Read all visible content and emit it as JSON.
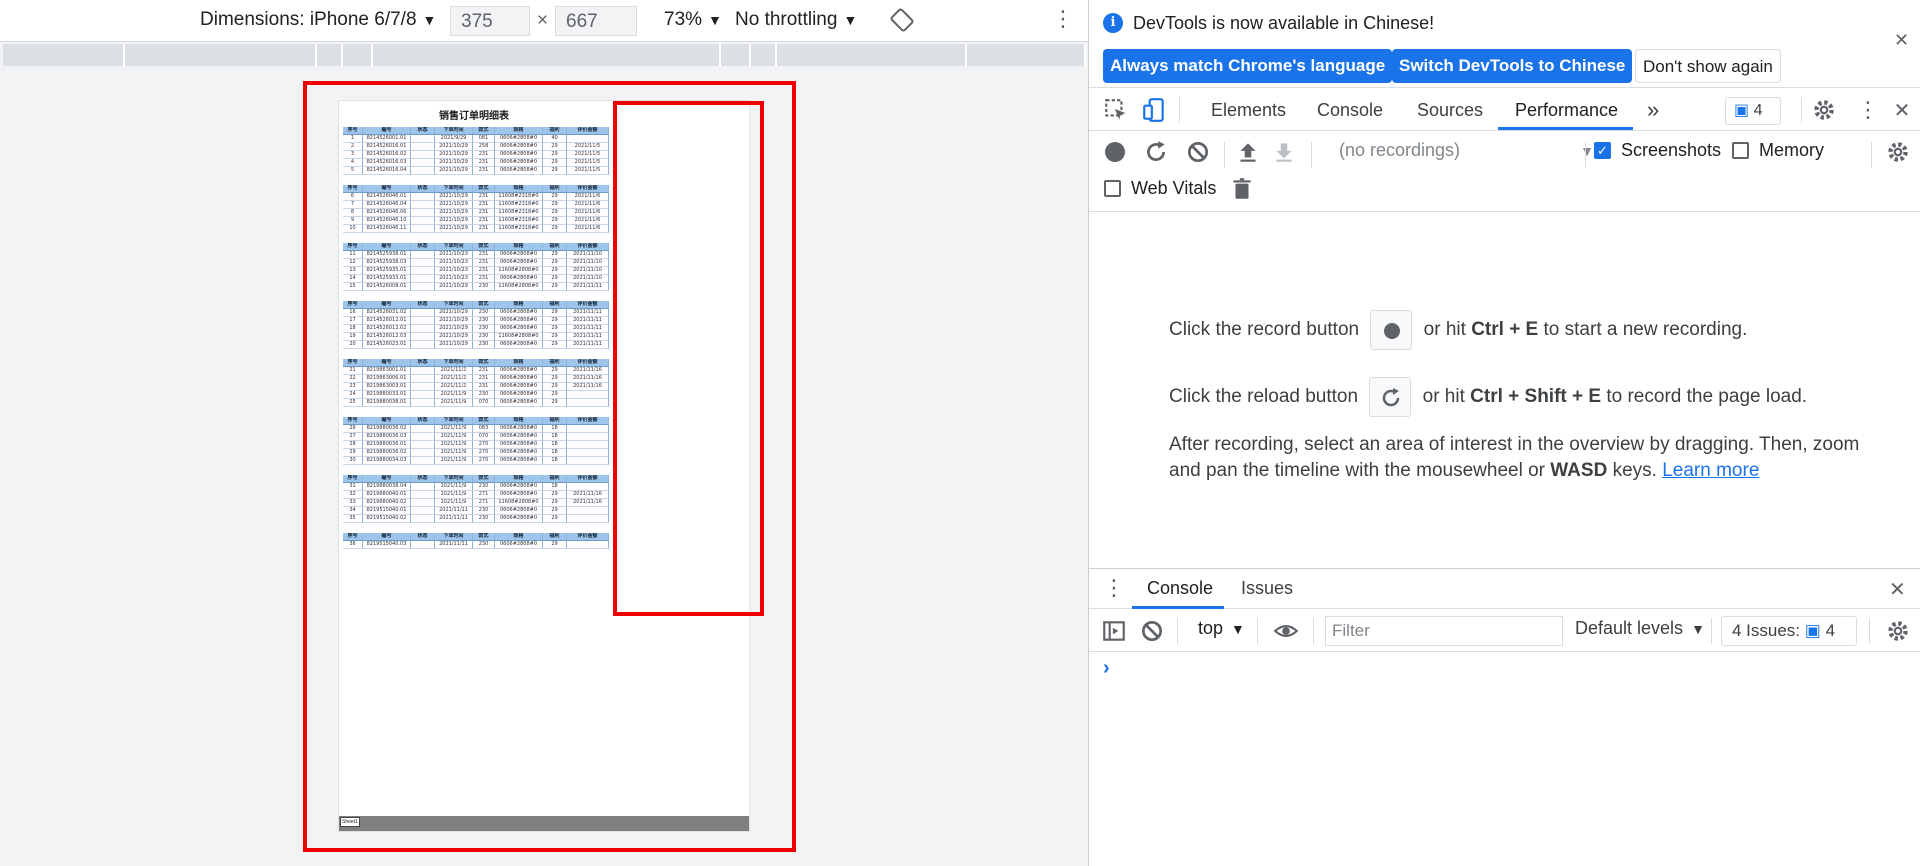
{
  "device_toolbar": {
    "dimensions_label": "Dimensions: iPhone 6/7/8",
    "width_value": "375",
    "height_value": "667",
    "times": "×",
    "zoom": "73%",
    "throttling": "No throttling"
  },
  "sheet": {
    "title": "销售订单明细表",
    "tab_name": "Sheet1",
    "headers": [
      "序号",
      "编号",
      "状态",
      "下单时间",
      "款式",
      "规格",
      "福利",
      "评价金额"
    ],
    "blocks": [
      [
        [
          "1",
          "8214526001.01",
          "",
          "2021/9/29",
          "081",
          "0606#2808#0",
          "40",
          ""
        ],
        [
          "2",
          "8214526016.01",
          "",
          "2021/10/29",
          "258",
          "0606#2808#0",
          "29",
          "2021/11/5"
        ],
        [
          "3",
          "8214526016.02",
          "",
          "2021/10/29",
          "231",
          "0606#2808#0",
          "29",
          "2021/11/5"
        ],
        [
          "4",
          "8214526016.03",
          "",
          "2021/10/29",
          "231",
          "0606#2808#0",
          "29",
          "2021/11/5"
        ],
        [
          "5",
          "8214526016.04",
          "",
          "2021/10/29",
          "231",
          "0606#2808#0",
          "29",
          "2021/11/5"
        ]
      ],
      [
        [
          "6",
          "8214526046.01",
          "",
          "2021/10/29",
          "231",
          "11608#2318#0",
          "29",
          "2021/11/6"
        ],
        [
          "7",
          "8214526046.04",
          "",
          "2021/10/29",
          "231",
          "11608#2318#0",
          "29",
          "2021/11/6"
        ],
        [
          "8",
          "8214526046.06",
          "",
          "2021/10/29",
          "231",
          "11608#2318#0",
          "29",
          "2021/11/6"
        ],
        [
          "9",
          "8214526046.10",
          "",
          "2021/10/29",
          "231",
          "11608#2318#0",
          "29",
          "2021/11/6"
        ],
        [
          "10",
          "8214526046.11",
          "",
          "2021/10/29",
          "231",
          "11608#2318#0",
          "29",
          "2021/11/6"
        ]
      ],
      [
        [
          "11",
          "8214525938.01",
          "",
          "2021/10/23",
          "231",
          "0606#2808#0",
          "29",
          "2021/11/10"
        ],
        [
          "12",
          "8214525938.03",
          "",
          "2021/10/23",
          "231",
          "0606#2808#0",
          "29",
          "2021/11/10"
        ],
        [
          "13",
          "8214525935.01",
          "",
          "2021/10/23",
          "231",
          "11608#2808#0",
          "29",
          "2021/11/10"
        ],
        [
          "14",
          "8214525933.01",
          "",
          "2021/10/23",
          "231",
          "0606#2808#0",
          "29",
          "2021/11/10"
        ],
        [
          "15",
          "8214526008.01",
          "",
          "2021/10/29",
          "230",
          "11608#2808#0",
          "29",
          "2021/11/11"
        ]
      ],
      [
        [
          "16",
          "8214526031.02",
          "",
          "2021/10/29",
          "230",
          "0606#2808#0",
          "29",
          "2021/11/11"
        ],
        [
          "17",
          "8214526012.01",
          "",
          "2021/10/29",
          "230",
          "0606#2808#0",
          "29",
          "2021/11/11"
        ],
        [
          "18",
          "8214526012.02",
          "",
          "2021/10/29",
          "230",
          "0606#2808#0",
          "29",
          "2021/11/11"
        ],
        [
          "19",
          "8214526012.03",
          "",
          "2021/10/29",
          "230",
          "11608#2808#0",
          "29",
          "2021/11/11"
        ],
        [
          "20",
          "8214526023.01",
          "",
          "2021/10/29",
          "230",
          "0606#2808#0",
          "29",
          "2021/11/11"
        ]
      ],
      [
        [
          "21",
          "8219863001.01",
          "",
          "2021/11/2",
          "231",
          "0606#2808#0",
          "29",
          "2021/11/16"
        ],
        [
          "22",
          "8219863006.01",
          "",
          "2021/11/2",
          "231",
          "0606#2808#0",
          "29",
          "2021/11/16"
        ],
        [
          "23",
          "8219863003.01",
          "",
          "2021/11/2",
          "231",
          "0606#2808#0",
          "29",
          "2021/11/16"
        ],
        [
          "24",
          "8219880033.01",
          "",
          "2021/11/9",
          "230",
          "0606#2808#0",
          "29",
          ""
        ],
        [
          "25",
          "8219880038.01",
          "",
          "2021/11/9",
          "070",
          "0606#2808#0",
          "29",
          ""
        ]
      ],
      [
        [
          "26",
          "8219880036.02",
          "",
          "2021/11/9",
          "083",
          "0606#2808#0",
          "18",
          ""
        ],
        [
          "27",
          "8219880036.03",
          "",
          "2021/11/9",
          "070",
          "0606#2808#0",
          "18",
          ""
        ],
        [
          "28",
          "8219880036.01",
          "",
          "2021/11/9",
          "270",
          "0606#2808#0",
          "18",
          ""
        ],
        [
          "29",
          "8219880036.02",
          "",
          "2021/11/9",
          "270",
          "0606#2808#0",
          "18",
          ""
        ],
        [
          "30",
          "8219880034.03",
          "",
          "2021/11/9",
          "270",
          "0606#2808#0",
          "18",
          ""
        ]
      ],
      [
        [
          "31",
          "8219880038.04",
          "",
          "2021/11/9",
          "230",
          "0606#2808#0",
          "18",
          ""
        ],
        [
          "32",
          "8219880040.01",
          "",
          "2021/11/9",
          "271",
          "0606#2808#0",
          "29",
          "2021/11/16"
        ],
        [
          "33",
          "8219880040.02",
          "",
          "2021/11/9",
          "271",
          "11608#2808#0",
          "29",
          "2021/11/16"
        ],
        [
          "34",
          "8219515040.01",
          "",
          "2021/11/11",
          "230",
          "0606#2808#0",
          "29",
          ""
        ],
        [
          "35",
          "8219515040.02",
          "",
          "2021/11/11",
          "230",
          "0606#2808#0",
          "29",
          ""
        ]
      ],
      [
        [
          "36",
          "8219515040.03",
          "",
          "2021/11/11",
          "230",
          "0606#2808#0",
          "29",
          ""
        ]
      ]
    ]
  },
  "devtools": {
    "infobar": {
      "message": "DevTools is now available in Chinese!",
      "btn_match": "Always match Chrome's language",
      "btn_switch": "Switch DevTools to Chinese",
      "btn_dont": "Don't show again"
    },
    "tabs": [
      "Elements",
      "Console",
      "Sources",
      "Performance"
    ],
    "more_tabs": "»",
    "issues_count": "4",
    "perf": {
      "no_recordings": "(no recordings)",
      "screenshots_label": "Screenshots",
      "memory_label": "Memory",
      "webvitals_label": "Web Vitals",
      "line1_a": "Click the record button",
      "line1_b": "or hit",
      "line1_key": "Ctrl + E",
      "line1_c": "to start a new recording.",
      "line2_a": "Click the reload button",
      "line2_b": "or hit",
      "line2_key": "Ctrl + Shift + E",
      "line2_c": "to record the page load.",
      "line3_a": "After recording, select an area of interest in the overview by dragging. Then, zoom and pan the timeline with the mousewheel or",
      "line3_key": "WASD",
      "line3_b": "keys.",
      "learn_more": "Learn more"
    },
    "drawer": {
      "tab_console": "Console",
      "tab_issues": "Issues",
      "context": "top",
      "filter_placeholder": "Filter",
      "levels": "Default levels",
      "issues_label": "4 Issues:",
      "issues_num": "4",
      "prompt": "›"
    }
  }
}
